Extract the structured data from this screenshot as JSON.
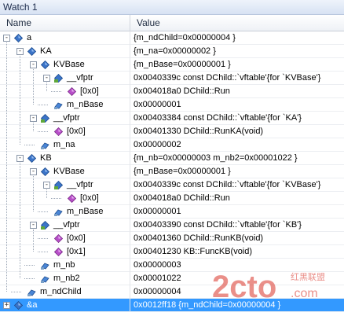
{
  "window": {
    "title": "Watch 1"
  },
  "columns": {
    "name": "Name",
    "value": "Value"
  },
  "rows": [
    {
      "name": "a",
      "value": "{m_ndChild=0x00000004 }"
    },
    {
      "name": "KA",
      "value": "{m_na=0x00000002 }"
    },
    {
      "name": "KVBase",
      "value": "{m_nBase=0x00000001 }"
    },
    {
      "name": "__vfptr",
      "value": "0x0040339c const DChild::`vftable'{for `KVBase'}"
    },
    {
      "name": "[0x0]",
      "value": "0x004018a0 DChild::Run"
    },
    {
      "name": "m_nBase",
      "value": "0x00000001"
    },
    {
      "name": "__vfptr",
      "value": "0x00403384 const DChild::`vftable'{for `KA'}"
    },
    {
      "name": "[0x0]",
      "value": "0x00401330 DChild::RunKA(void)"
    },
    {
      "name": "m_na",
      "value": "0x00000002"
    },
    {
      "name": "KB",
      "value": "{m_nb=0x00000003 m_nb2=0x00001022 }"
    },
    {
      "name": "KVBase",
      "value": "{m_nBase=0x00000001 }"
    },
    {
      "name": "__vfptr",
      "value": "0x0040339c const DChild::`vftable'{for `KVBase'}"
    },
    {
      "name": "[0x0]",
      "value": "0x004018a0 DChild::Run"
    },
    {
      "name": "m_nBase",
      "value": "0x00000001"
    },
    {
      "name": "__vfptr",
      "value": "0x00403390 const DChild::`vftable'{for `KB'}"
    },
    {
      "name": "[0x0]",
      "value": "0x00401360 DChild::RunKB(void)"
    },
    {
      "name": "[0x1]",
      "value": "0x00401230 KB::FuncKB(void)"
    },
    {
      "name": "m_nb",
      "value": "0x00000003"
    },
    {
      "name": "m_nb2",
      "value": "0x00001022"
    },
    {
      "name": "m_ndChild",
      "value": "0x00000004"
    },
    {
      "name": "&a",
      "value": "0x0012ff18 {m_ndChild=0x00000004 }"
    }
  ],
  "watermark": {
    "logo": "2cto",
    "sub": "红黑联盟",
    "suffix": ".com",
    "color": "#d9352a"
  },
  "colors": {
    "selection": "#3399ff"
  }
}
